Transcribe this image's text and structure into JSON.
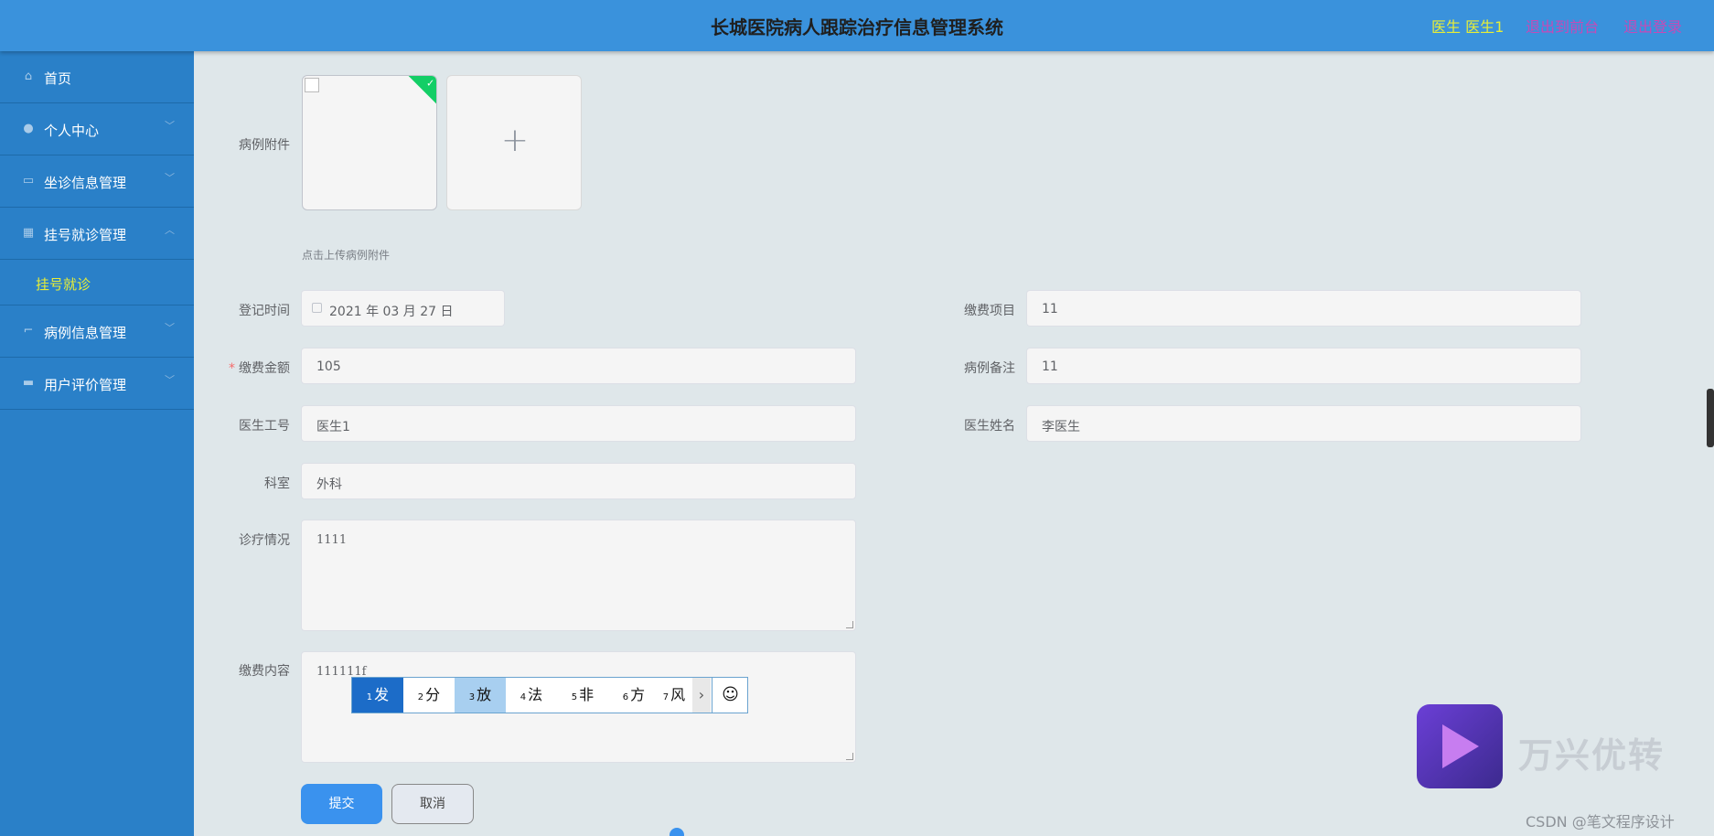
{
  "header": {
    "title": "长城医院病人跟踪治疗信息管理系统",
    "user": "医生 医生1",
    "exit_frontend": "退出到前台",
    "logout": "退出登录"
  },
  "sidebar": {
    "items": [
      {
        "label": "首页",
        "icon": "home-icon"
      },
      {
        "label": "个人中心",
        "icon": "user-icon"
      },
      {
        "label": "坐诊信息管理",
        "icon": "chat-icon"
      },
      {
        "label": "挂号就诊管理",
        "icon": "grid-icon"
      },
      {
        "label": "病例信息管理",
        "icon": "crop-icon"
      },
      {
        "label": "用户评价管理",
        "icon": "picture-icon"
      }
    ],
    "sub_item": "挂号就诊"
  },
  "form": {
    "attachment_label": "病例附件",
    "upload_tip": "点击上传病例附件",
    "reg_time_label": "登记时间",
    "reg_time_value": "2021 年 03 月 27 日",
    "fee_item_label": "缴费项目",
    "fee_item_value": "11",
    "amount_label": "缴费金额",
    "amount_value": "105",
    "remark_label": "病例备注",
    "remark_value": "11",
    "doctor_id_label": "医生工号",
    "doctor_id_value": "医生1",
    "doctor_name_label": "医生姓名",
    "doctor_name_value": "李医生",
    "dept_label": "科室",
    "dept_value": "外科",
    "diagnosis_label": "诊疗情况",
    "diagnosis_value": "1111",
    "content_label": "缴费内容",
    "content_value": "111111f",
    "submit": "提交",
    "cancel": "取消"
  },
  "ime": {
    "candidates": [
      {
        "num": "1",
        "char": "发"
      },
      {
        "num": "2",
        "char": "分"
      },
      {
        "num": "3",
        "char": "放"
      },
      {
        "num": "4",
        "char": "法"
      },
      {
        "num": "5",
        "char": "非"
      },
      {
        "num": "6",
        "char": "方"
      },
      {
        "num": "7",
        "char": "风"
      }
    ]
  },
  "watermark": {
    "brand": "万兴优转",
    "credit": "CSDN @笔文程序设计"
  }
}
